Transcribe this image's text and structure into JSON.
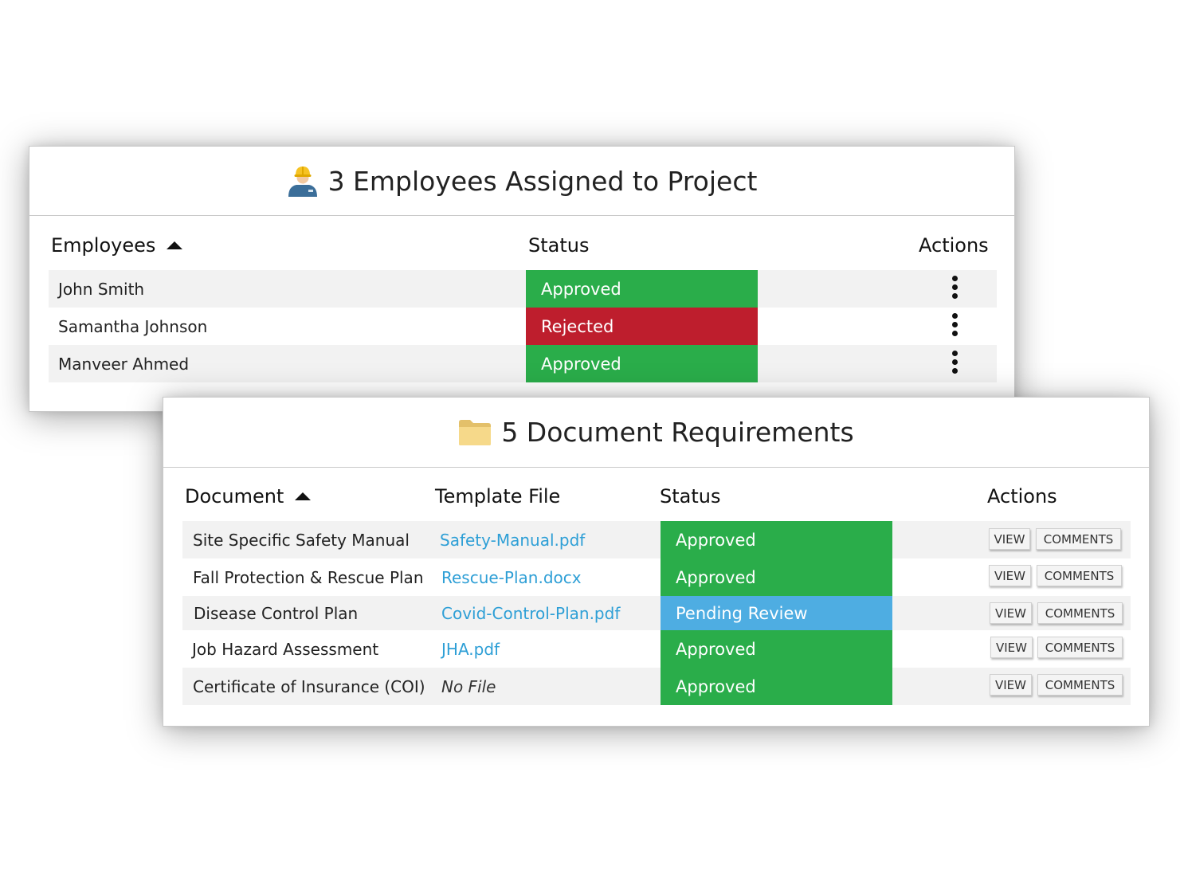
{
  "colors": {
    "approved": "#2aad4a",
    "rejected": "#be1e2d",
    "pending_review": "#4eade2",
    "link": "#2e9fd6",
    "row_alt": "#f2f2f2"
  },
  "employees_panel": {
    "icon": "construction-worker-icon",
    "title": "3 Employees Assigned to Project",
    "columns": {
      "employees": "Employees",
      "status": "Status",
      "actions": "Actions"
    },
    "sort": "ascending",
    "rows": [
      {
        "name": "John Smith",
        "status": "Approved"
      },
      {
        "name": "Samantha Johnson",
        "status": "Rejected"
      },
      {
        "name": "Manveer Ahmed",
        "status": "Approved"
      }
    ]
  },
  "documents_panel": {
    "icon": "folder-icon",
    "title": "5 Document Requirements",
    "columns": {
      "document": "Document",
      "template_file": "Template File",
      "status": "Status",
      "actions": "Actions"
    },
    "sort": "ascending",
    "buttons": {
      "view": "VIEW",
      "comments": "COMMENTS"
    },
    "rows": [
      {
        "document": "Site Specific Safety Manual",
        "template": "Safety-Manual.pdf",
        "status": "Approved"
      },
      {
        "document": "Fall Protection & Rescue Plan",
        "template": "Rescue-Plan.docx",
        "status": "Approved"
      },
      {
        "document": "Disease Control Plan",
        "template": "Covid-Control-Plan.pdf",
        "status": "Pending Review"
      },
      {
        "document": "Job Hazard Assessment",
        "template": "JHA.pdf",
        "status": "Approved"
      },
      {
        "document": "Certificate of Insurance (COI)",
        "template": "No File",
        "status": "Approved"
      }
    ]
  }
}
